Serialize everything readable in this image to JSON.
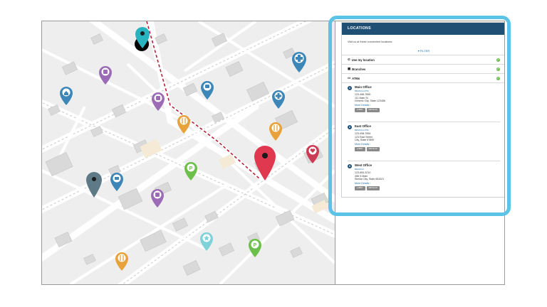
{
  "panel": {
    "title": "LOCATIONS",
    "intro": "Visit us at these convenient locations:",
    "filter_label": "▾ FILTER",
    "accordions": [
      {
        "icon": "⊙",
        "label": "Use my location"
      },
      {
        "icon": "▦",
        "label": "Branches"
      },
      {
        "icon": "▭",
        "label": "ATMs"
      }
    ],
    "locations": [
      {
        "num": "1",
        "name": "Main Office",
        "type": "BRANCH ATM",
        "phone": "123-456-7890",
        "addr1": "111 Main St",
        "addr2": "Generic City, State 123456",
        "more": "More Details ›",
        "btn1": "LOBBY",
        "btn2": "DRIVE UP"
      },
      {
        "num": "2",
        "name": "East Office",
        "type": "BRANCH ATM",
        "phone": "123-098-7654",
        "addr1": "123 East Street",
        "addr2": "City, State 67890",
        "more": "More Details ›",
        "btn1": "LOBBY",
        "btn2": "DRIVE UP"
      },
      {
        "num": "3",
        "name": "West Office",
        "type": "BRANCH",
        "phone": "123-654-3210",
        "addr1": "456 S Main",
        "addr2": "Similar City, State 654321",
        "more": "More Details ›",
        "btn1": "LOBBY",
        "btn2": "DRIVE UP"
      }
    ]
  },
  "colors": {
    "header": "#1f4f73",
    "highlight": "#5bc3e6",
    "route": "#b5203a",
    "selected_pin": "#e0384f"
  },
  "map_pins": [
    {
      "name": "pin-teal-selected-icon",
      "color": "#27b3bf"
    },
    {
      "name": "pin-bus-icon",
      "color": "#9b6cb5"
    },
    {
      "name": "pin-hospital-icon",
      "color": "#3d86b8"
    },
    {
      "name": "pin-home-icon",
      "color": "#3d86b8"
    },
    {
      "name": "pin-car-icon",
      "color": "#3d86b8"
    },
    {
      "name": "pin-bus-icon",
      "color": "#9b6cb5"
    },
    {
      "name": "pin-hospital-icon",
      "color": "#3d86b8"
    },
    {
      "name": "pin-restaurant-icon",
      "color": "#e8a23b"
    },
    {
      "name": "pin-restaurant-icon",
      "color": "#e8a23b"
    },
    {
      "name": "pin-destination-icon",
      "color": "#e0384f"
    },
    {
      "name": "pin-heart-icon",
      "color": "#cc3b55"
    },
    {
      "name": "pin-gray-icon",
      "color": "#5e7a87"
    },
    {
      "name": "pin-shopping-icon",
      "color": "#3d86b8"
    },
    {
      "name": "pin-parking-icon",
      "color": "#6cc04a"
    },
    {
      "name": "pin-bus-icon",
      "color": "#9b6cb5"
    },
    {
      "name": "pin-star-icon",
      "color": "#7fd3d8"
    },
    {
      "name": "pin-parking-icon",
      "color": "#6cc04a"
    },
    {
      "name": "pin-restaurant-icon",
      "color": "#e8a23b"
    }
  ]
}
